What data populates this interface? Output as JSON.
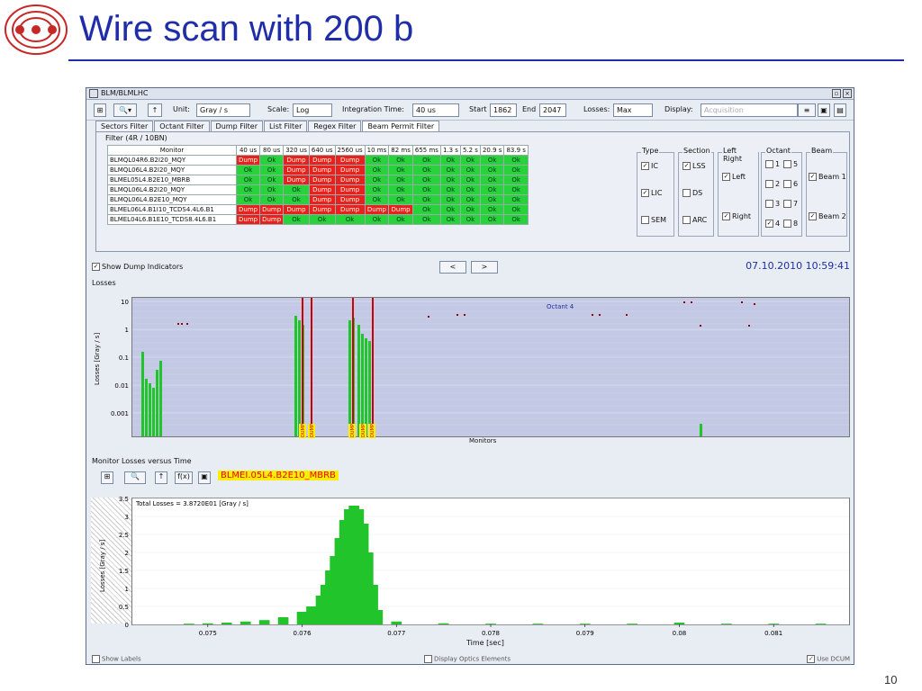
{
  "slide": {
    "title": "Wire scan with 200 b",
    "page_number": "10"
  },
  "window": {
    "title": "BLM/BLMLHC"
  },
  "toolbar": {
    "unit_label": "Unit:",
    "unit_value": "Gray / s",
    "scale_label": "Scale:",
    "scale_value": "Log",
    "integration_label": "Integration Time:",
    "integration_value": "40 us",
    "start_label": "Start",
    "start_value": "1862",
    "end_label": "End",
    "end_value": "2047",
    "losses_label": "Losses:",
    "losses_value": "Max",
    "display_label": "Display:",
    "display_value": "Acquisition"
  },
  "filter_tabs": [
    "Sectors Filter",
    "Octant Filter",
    "Dump Filter",
    "List Filter",
    "Regex Filter",
    "Beam Permit Filter"
  ],
  "filter_label": "Filter (4R / 10BN)",
  "table": {
    "headers": [
      "Monitor",
      "40 us",
      "80 us",
      "320 us",
      "640 us",
      "2560 us",
      "10 ms",
      "82 ms",
      "655 ms",
      "1.3 s",
      "5.2 s",
      "20.9 s",
      "83.9 s"
    ],
    "rows": [
      {
        "name": "BLMQL04R6.B2I20_MQY",
        "cells": [
          "Dump",
          "Ok",
          "Dump",
          "Dump",
          "Dump",
          "Ok",
          "Ok",
          "Ok",
          "Ok",
          "Ok",
          "Ok",
          "Ok"
        ]
      },
      {
        "name": "BLMQL06L4.B2I20_MQY",
        "cells": [
          "Ok",
          "Ok",
          "Dump",
          "Dump",
          "Dump",
          "Ok",
          "Ok",
          "Ok",
          "Ok",
          "Ok",
          "Ok",
          "Ok"
        ]
      },
      {
        "name": "BLMEL05L4.B2E10_MBRB",
        "cells": [
          "Ok",
          "Ok",
          "Dump",
          "Dump",
          "Dump",
          "Ok",
          "Ok",
          "Ok",
          "Ok",
          "Ok",
          "Ok",
          "Ok"
        ]
      },
      {
        "name": "BLMQL06L4.B2I20_MQY",
        "cells": [
          "Ok",
          "Ok",
          "Ok",
          "Dump",
          "Dump",
          "Ok",
          "Ok",
          "Ok",
          "Ok",
          "Ok",
          "Ok",
          "Ok"
        ]
      },
      {
        "name": "BLMQL06L4.B2E10_MQY",
        "cells": [
          "Ok",
          "Ok",
          "Ok",
          "Dump",
          "Dump",
          "Ok",
          "Ok",
          "Ok",
          "Ok",
          "Ok",
          "Ok",
          "Ok"
        ]
      },
      {
        "name": "BLMEL06L4.B1I10_TCDS4.4L6.B1",
        "cells": [
          "Dump",
          "Dump",
          "Dump",
          "Dump",
          "Dump",
          "Dump",
          "Dump",
          "Ok",
          "Ok",
          "Ok",
          "Ok",
          "Ok"
        ]
      },
      {
        "name": "BLMEL04L6.B1E10_TCDS8.4L6.B1",
        "cells": [
          "Dump",
          "Dump",
          "Ok",
          "Ok",
          "Ok",
          "Ok",
          "Ok",
          "Ok",
          "Ok",
          "Ok",
          "Ok",
          "Ok"
        ]
      }
    ]
  },
  "groups": {
    "type": {
      "title": "Type",
      "items": [
        "IC",
        "LIC",
        "SEM"
      ]
    },
    "section": {
      "title": "Section",
      "items": [
        "LSS",
        "DS",
        "ARC"
      ]
    },
    "leftright": {
      "title": "Left Right",
      "items": [
        "Left",
        "Right"
      ]
    },
    "octant": {
      "title": "Octant",
      "items": [
        "1",
        "5",
        "2",
        "6",
        "3",
        "7",
        "4",
        "8"
      ]
    },
    "beam": {
      "title": "Beam",
      "items": [
        "Beam 1",
        "Beam 2"
      ]
    }
  },
  "dump": {
    "show_label": "Show Dump Indicators",
    "prev": "<",
    "next": ">",
    "timestamp": "07.10.2010 10:59:41"
  },
  "losses_panel": {
    "title": "Losses",
    "ylabel": "Losses [Gray / s]",
    "xlabel": "Monitors",
    "octant_label": "Octant 4",
    "yticks": [
      "10",
      "1",
      "0.1",
      "0.01",
      "0.001"
    ],
    "dump_markers": [
      "DUMP",
      "DUMP",
      "DUMP",
      "DUMP",
      "DUMP"
    ]
  },
  "mlvt": {
    "title": "Monitor Losses versus Time",
    "monitor": "BLMEI.05L4.B2E10_MBRB",
    "fx": "f(x)"
  },
  "chart_data": {
    "type": "bar",
    "title": "Total Losses = 3.8720E01 [Gray / s]",
    "xlabel": "Time [sec]",
    "ylabel": "Losses [Gray / s]",
    "xlim": [
      0.0742,
      0.0818
    ],
    "ylim": [
      0,
      3.5
    ],
    "xticks": [
      "0.075",
      "0.076",
      "0.077",
      "0.078",
      "0.079",
      "0.08",
      "0.081"
    ],
    "yticks": [
      "0",
      "0.5",
      "1",
      "1.5",
      "2",
      "2.5",
      "3",
      "3.5"
    ],
    "x": [
      0.0748,
      0.075,
      0.0752,
      0.0754,
      0.0756,
      0.0758,
      0.076,
      0.0761,
      0.0762,
      0.07625,
      0.0763,
      0.07635,
      0.0764,
      0.07645,
      0.0765,
      0.07655,
      0.0766,
      0.07665,
      0.0767,
      0.07675,
      0.0768,
      0.077,
      0.0775,
      0.078,
      0.0785,
      0.079,
      0.0795,
      0.08,
      0.0805,
      0.081,
      0.0815
    ],
    "values": [
      0.02,
      0.03,
      0.05,
      0.08,
      0.12,
      0.2,
      0.35,
      0.5,
      0.8,
      1.1,
      1.5,
      1.9,
      2.4,
      2.9,
      3.2,
      3.3,
      3.2,
      2.8,
      2.0,
      1.1,
      0.4,
      0.08,
      0.03,
      0.02,
      0.02,
      0.02,
      0.02,
      0.05,
      0.02,
      0.02,
      0.02
    ]
  },
  "bottom": {
    "show_labels": "Show Labels",
    "display_optics": "Display Optics Elements",
    "use_dcum": "Use DCUM"
  }
}
